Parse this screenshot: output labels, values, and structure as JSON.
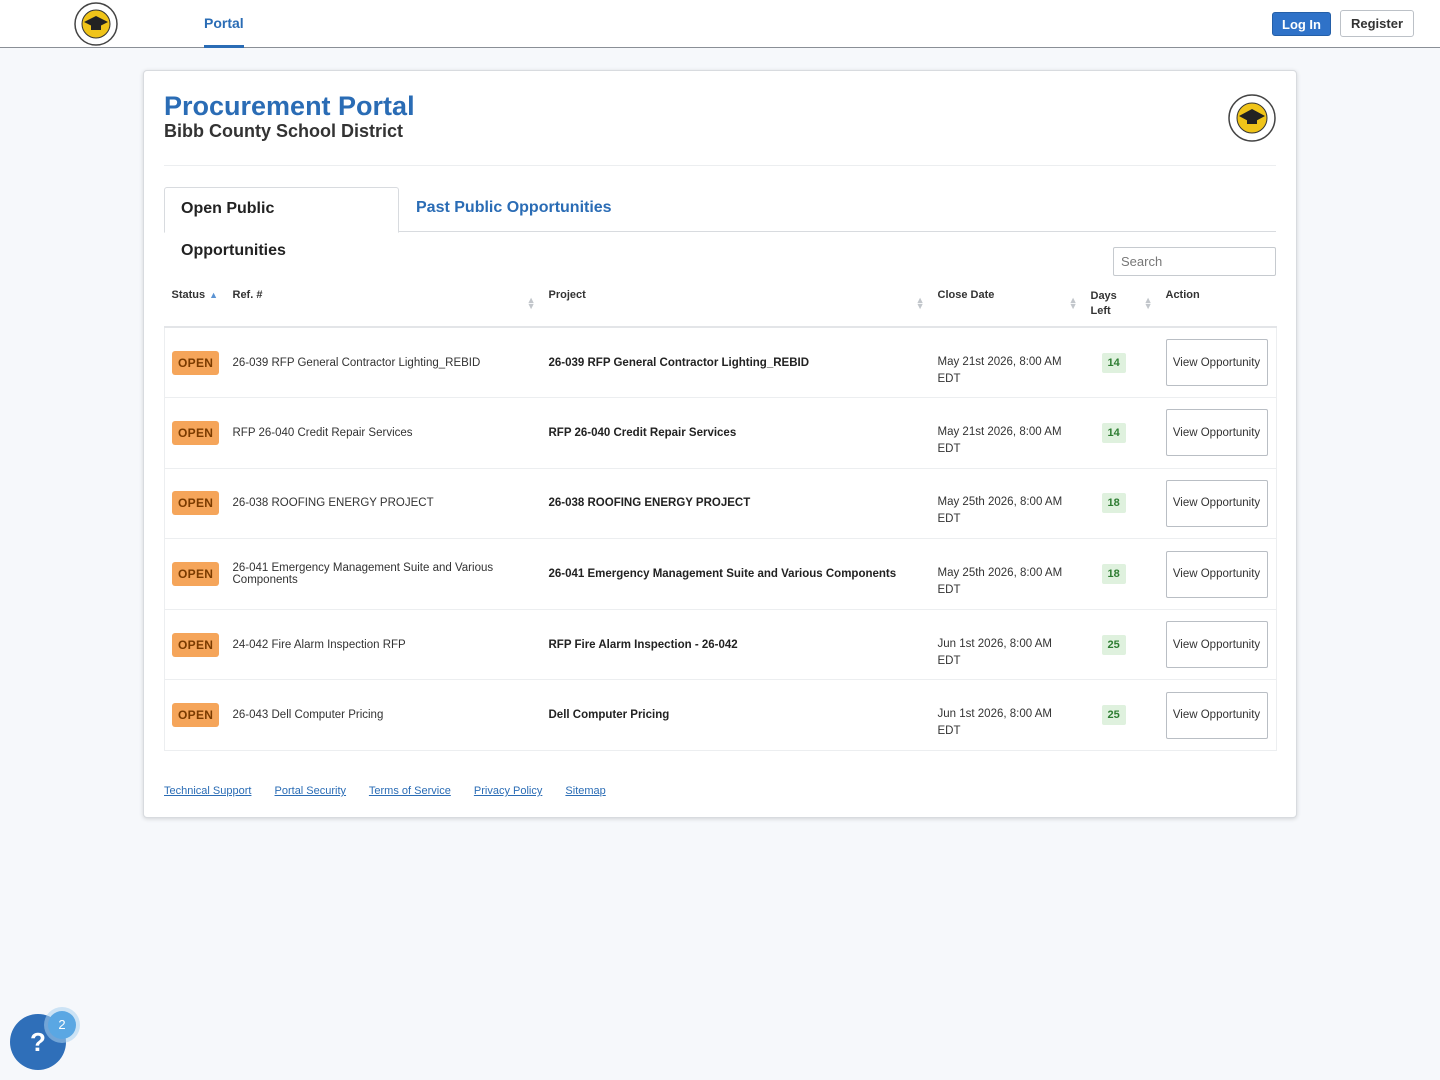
{
  "topbar": {
    "nav_portal": "Portal",
    "login_label": "Log In",
    "register_label": "Register"
  },
  "header": {
    "title": "Procurement Portal",
    "subtitle": "Bibb County School District"
  },
  "tabs": [
    {
      "label": "Open Public Opportunities",
      "active": true
    },
    {
      "label": "Past Public Opportunities",
      "active": false
    }
  ],
  "search": {
    "placeholder": "Search"
  },
  "table": {
    "columns": {
      "status": "Status",
      "ref": "Ref. #",
      "project": "Project",
      "close_date": "Close Date",
      "days_left": "Days Left",
      "action": "Action"
    },
    "rows": [
      {
        "status": "OPEN",
        "ref": "26-039 RFP General Contractor Lighting_REBID",
        "project": "26-039 RFP General Contractor Lighting_REBID",
        "close_date": "May 21st 2026, 8:00 AM",
        "tz": "EDT",
        "days_left": "14",
        "action": "View Opportunity"
      },
      {
        "status": "OPEN",
        "ref": "RFP 26-040 Credit Repair Services",
        "project": "RFP 26-040 Credit Repair Services",
        "close_date": "May 21st 2026, 8:00 AM",
        "tz": "EDT",
        "days_left": "14",
        "action": "View Opportunity"
      },
      {
        "status": "OPEN",
        "ref": "26-038 ROOFING ENERGY PROJECT",
        "project": "26-038 ROOFING ENERGY PROJECT",
        "close_date": "May 25th 2026, 8:00 AM",
        "tz": "EDT",
        "days_left": "18",
        "action": "View Opportunity"
      },
      {
        "status": "OPEN",
        "ref": "26-041 Emergency Management Suite and Various Components",
        "project": "26-041 Emergency Management Suite and Various Components",
        "close_date": "May 25th 2026, 8:00 AM",
        "tz": "EDT",
        "days_left": "18",
        "action": "View Opportunity"
      },
      {
        "status": "OPEN",
        "ref": "24-042 Fire Alarm Inspection RFP",
        "project": "RFP Fire Alarm Inspection - 26-042",
        "close_date": "Jun 1st 2026, 8:00 AM",
        "tz": "EDT",
        "days_left": "25",
        "action": "View Opportunity"
      },
      {
        "status": "OPEN",
        "ref": "26-043 Dell Computer Pricing",
        "project": "Dell Computer Pricing",
        "close_date": "Jun 1st 2026, 8:00 AM",
        "tz": "EDT",
        "days_left": "25",
        "action": "View Opportunity"
      }
    ]
  },
  "footer_links": [
    "Technical Support",
    "Portal Security",
    "Terms of Service",
    "Privacy Policy",
    "Sitemap"
  ],
  "help": {
    "icon": "question-icon",
    "label": "?",
    "count": "2"
  },
  "colors": {
    "brand_blue": "#2a6cb5",
    "open_badge": "#f5a55a",
    "days_badge": "#dff1de"
  }
}
